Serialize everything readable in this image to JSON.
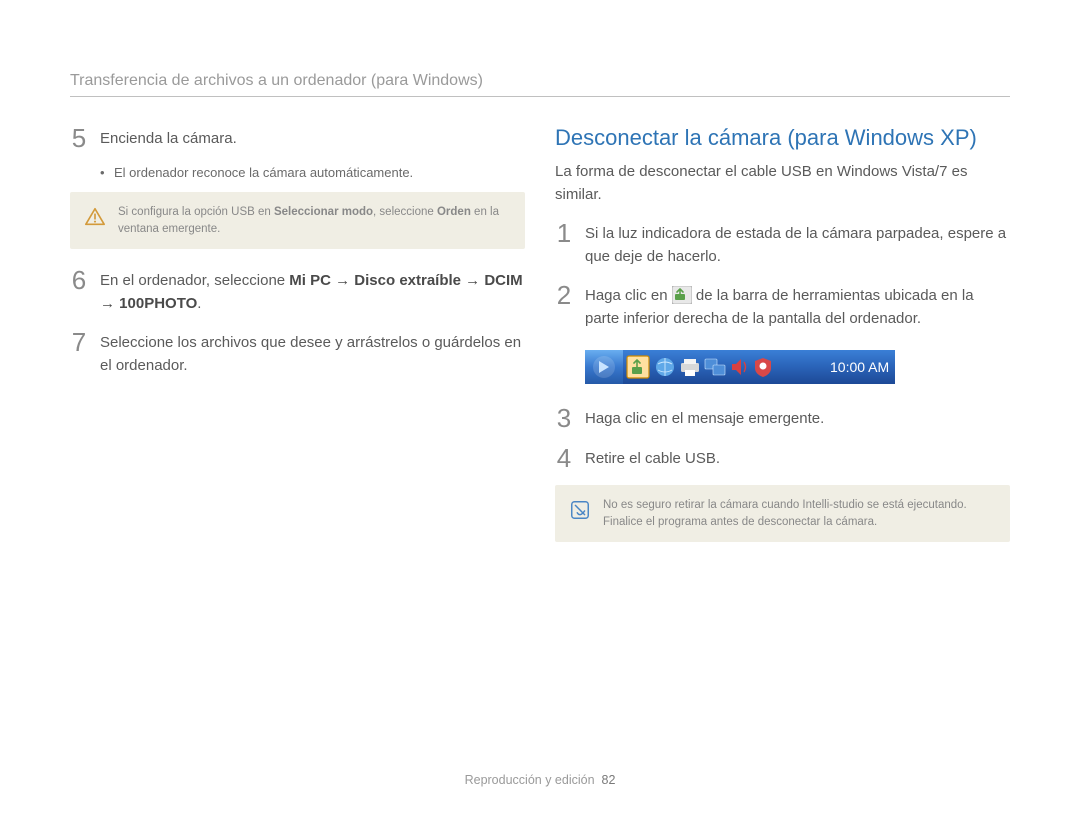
{
  "breadcrumb": "Transferencia de archivos a un ordenador (para Windows)",
  "left": {
    "step5_num": "5",
    "step5_text": "Encienda la cámara.",
    "step5_bullet": "El ordenador reconoce la cámara automáticamente.",
    "warn_pre": "Si configura la opción USB en ",
    "warn_b1": "Seleccionar modo",
    "warn_mid": ", seleccione ",
    "warn_b2": "Orden",
    "warn_post": " en la ventana emergente.",
    "step6_num": "6",
    "step6_pre": "En el ordenador, seleccione ",
    "step6_b": "Mi PC → Disco extraíble → DCIM → 100PHOTO",
    "step6_post": ".",
    "step7_num": "7",
    "step7_text": "Seleccione los archivos que desee y arrástrelos o guárdelos en el ordenador."
  },
  "right": {
    "title": "Desconectar la cámara (para Windows XP)",
    "intro": "La forma de desconectar el cable USB en Windows Vista/7 es similar.",
    "step1_num": "1",
    "step1_text": "Si la luz indicadora de estada de la cámara parpadea, espere a que deje de hacerlo.",
    "step2_num": "2",
    "step2_pre": "Haga clic en ",
    "step2_post": " de la barra de herramientas ubicada en la parte inferior derecha de la pantalla del ordenador.",
    "tray_time": "10:00 AM",
    "step3_num": "3",
    "step3_text": "Haga clic en el mensaje emergente.",
    "step4_num": "4",
    "step4_text": "Retire el cable USB.",
    "note_text": "No es seguro retirar la cámara cuando Intelli-studio se está ejecutando. Finalice el programa antes de desconectar la cámara."
  },
  "footer": {
    "section": "Reproducción y edición",
    "page": "82"
  }
}
